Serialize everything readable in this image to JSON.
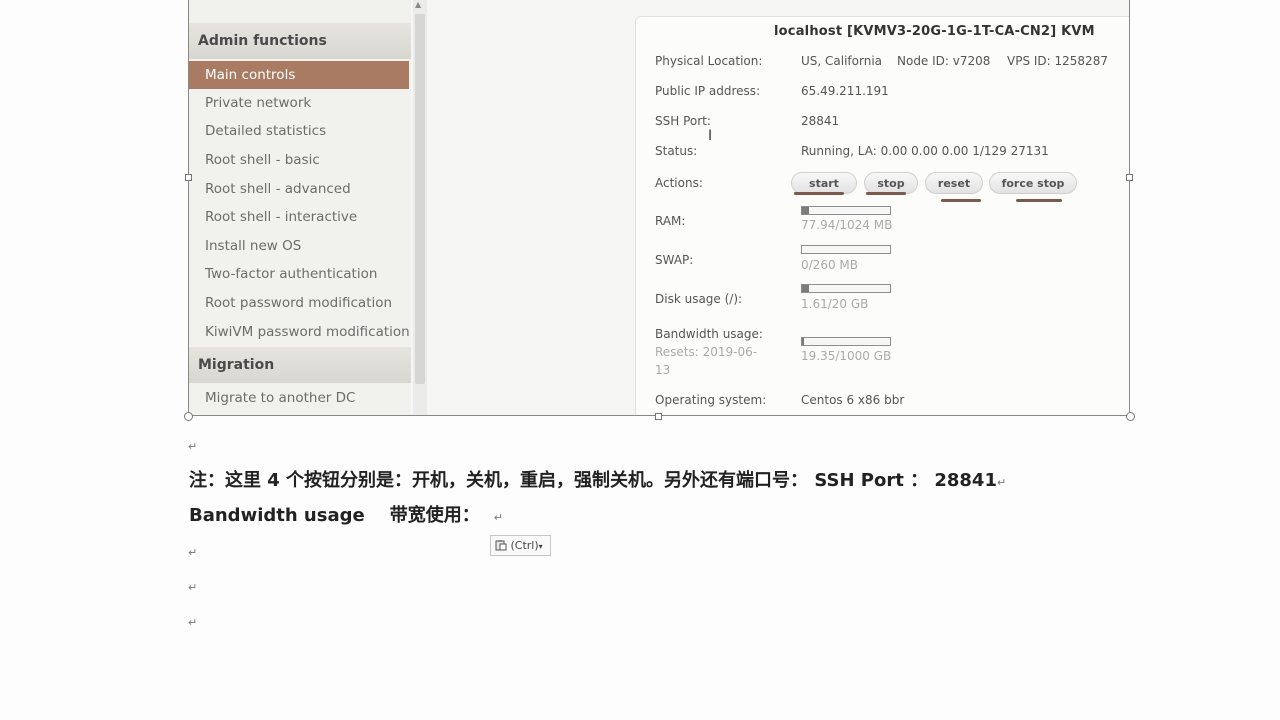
{
  "sidebar": {
    "section_admin": "Admin functions",
    "items": [
      {
        "label": "Main controls"
      },
      {
        "label": "Private network"
      },
      {
        "label": "Detailed statistics"
      },
      {
        "label": "Root shell - basic"
      },
      {
        "label": "Root shell - advanced"
      },
      {
        "label": "Root shell - interactive"
      },
      {
        "label": "Install new OS"
      },
      {
        "label": "Two-factor authentication"
      },
      {
        "label": "Root password modification"
      },
      {
        "label": "KiwiVM password modification"
      }
    ],
    "section_migration": "Migration",
    "migration_items": [
      {
        "label": "Migrate to another DC"
      }
    ]
  },
  "panel": {
    "title": "localhost  [KVMV3-20G-1G-1T-CA-CN2]  KVM",
    "physical_location_label": "Physical Location:",
    "physical_location": "US, California",
    "node_id": "Node ID: v7208",
    "vps_id": "VPS ID: 1258287",
    "ip_label": "Public IP address:",
    "ip": "65.49.211.191",
    "ssh_label": "SSH Port:",
    "ssh_port": "28841",
    "status_label": "Status:",
    "status": "Running, LA: 0.00 0.00 0.00 1/129 27131",
    "actions_label": "Actions:",
    "buttons": {
      "start": "start",
      "stop": "stop",
      "reset": "reset",
      "force_stop": "force stop"
    },
    "ram_label": "RAM:",
    "ram_value": "77.94/1024 MB",
    "ram_fraction": 0.076,
    "swap_label": "SWAP:",
    "swap_value": "0/260 MB",
    "swap_fraction": 0,
    "disk_label": "Disk usage (/):",
    "disk_value": "1.61/20 GB",
    "disk_fraction": 0.08,
    "bw_label": "Bandwidth usage:",
    "bw_resets": "Resets: 2019-06-",
    "bw_resets_2": "13",
    "bw_value": "19.35/1000 GB",
    "bw_fraction": 0.019,
    "os_label": "Operating system:",
    "os": "Centos 6 x86 bbr"
  },
  "doc": {
    "note_line1": "注：这里 4 个按钮分别是：开机，关机，重启，强制关机。另外还有端口号：  SSH Port  ：  28841",
    "note_line2": "Bandwidth usage    带宽使用：",
    "para_mark": "↵",
    "paste_label": "(Ctrl)"
  },
  "colors": {
    "sidebar_active": "#a97b63",
    "annotation_underline": "#7a5a4c"
  }
}
